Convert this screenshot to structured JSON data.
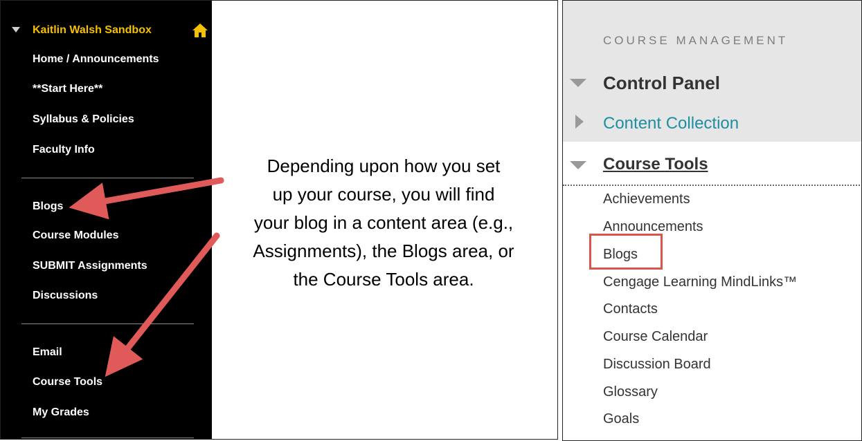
{
  "left_panel": {
    "course_title": "Kaitlin Walsh Sandbox",
    "menu_items": [
      "Home / Announcements",
      "**Start Here**",
      "Syllabus & Policies",
      "Faculty Info",
      "Blogs",
      "Course Modules",
      "SUBMIT Assignments",
      "Discussions",
      "Email",
      "Course Tools",
      "My Grades"
    ],
    "callout_lines": [
      "Depending upon how you set",
      "up your course, you will find",
      "your blog in a content area (e.g.,",
      "Assignments), the Blogs area, or",
      "the Course Tools area."
    ]
  },
  "right_panel": {
    "section_heading": "COURSE MANAGEMENT",
    "control_panel_label": "Control Panel",
    "content_collection_label": "Content Collection",
    "course_tools_label": "Course Tools",
    "tools": [
      "Achievements",
      "Announcements",
      "Blogs",
      "Cengage Learning MindLinks™",
      "Contacts",
      "Course Calendar",
      "Discussion Board",
      "Glossary",
      "Goals"
    ]
  },
  "colors": {
    "course_title": "#f5c000",
    "arrow": "#e05a5a",
    "highlight_box": "#d9534f",
    "link": "#1f8ea1"
  }
}
